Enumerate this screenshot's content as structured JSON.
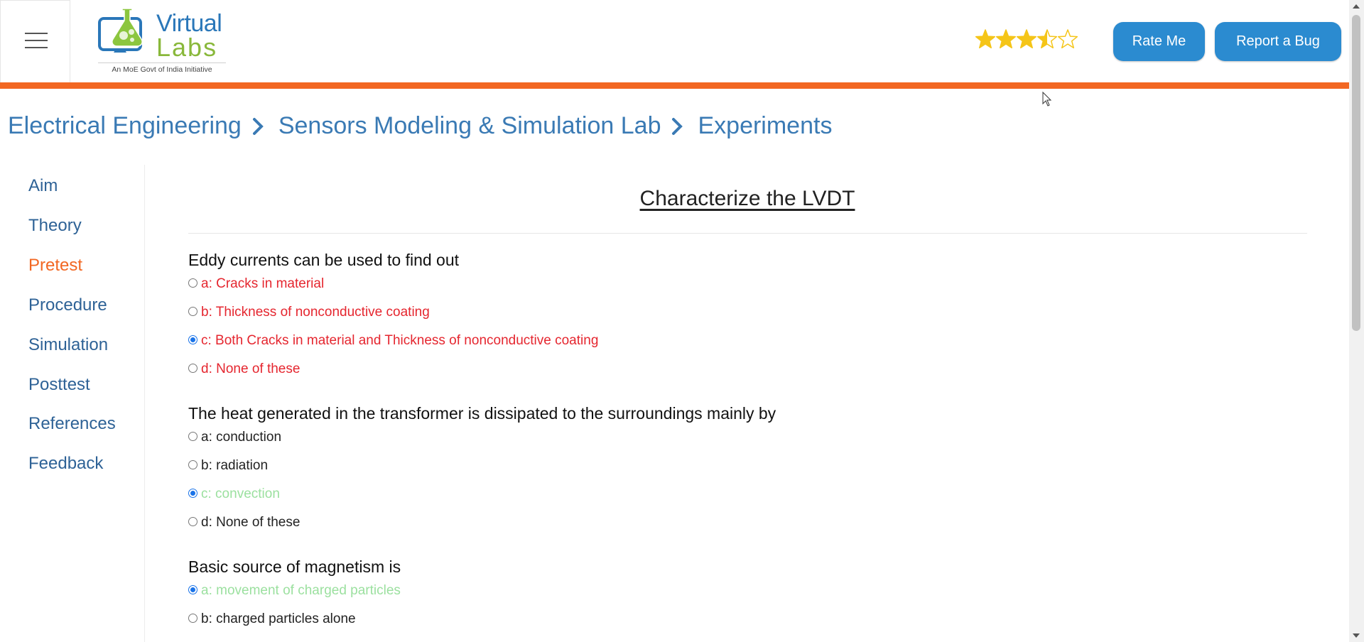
{
  "header": {
    "logo": {
      "line1": "Virtual",
      "line2": "Labs",
      "tagline": "An MoE Govt of India Initiative"
    },
    "rating": {
      "value": 3.5,
      "max": 5,
      "star_color": "#f5c518"
    },
    "buttons": {
      "rate": "Rate Me",
      "bug": "Report a Bug"
    },
    "accent": "#f26722",
    "button_color": "#2b8bd0"
  },
  "breadcrumb": [
    "Electrical Engineering",
    "Sensors Modeling & Simulation Lab",
    "Experiments"
  ],
  "sidebar": {
    "items": [
      {
        "label": "Aim"
      },
      {
        "label": "Theory"
      },
      {
        "label": "Pretest",
        "active": true
      },
      {
        "label": "Procedure"
      },
      {
        "label": "Simulation"
      },
      {
        "label": "Posttest"
      },
      {
        "label": "References"
      },
      {
        "label": "Feedback"
      }
    ]
  },
  "main": {
    "title": "Characterize the LVDT",
    "questions": [
      {
        "text": "Eddy currents can be used to find out",
        "options": [
          {
            "label": "a: Cracks in material",
            "checked": false,
            "state": "wrong"
          },
          {
            "label": "b: Thickness of nonconductive coating",
            "checked": false,
            "state": "wrong"
          },
          {
            "label": "c: Both Cracks in material and Thickness of nonconductive coating",
            "checked": true,
            "state": "wrong"
          },
          {
            "label": "d: None of these",
            "checked": false,
            "state": "wrong"
          }
        ]
      },
      {
        "text": "The heat generated in the transformer is dissipated to the surroundings mainly by",
        "options": [
          {
            "label": "a: conduction",
            "checked": false,
            "state": "neutral"
          },
          {
            "label": "b: radiation",
            "checked": false,
            "state": "neutral"
          },
          {
            "label": "c: convection",
            "checked": true,
            "state": "correct"
          },
          {
            "label": "d: None of these",
            "checked": false,
            "state": "neutral"
          }
        ]
      },
      {
        "text": "Basic source of magnetism is",
        "options": [
          {
            "label": "a: movement of charged particles",
            "checked": true,
            "state": "correct"
          },
          {
            "label": "b: charged particles alone",
            "checked": false,
            "state": "neutral"
          }
        ]
      }
    ]
  },
  "colors": {
    "wrong": "#e5262f",
    "correct": "#9be09f",
    "link": "#3a7ab4",
    "active_nav": "#f26722"
  }
}
